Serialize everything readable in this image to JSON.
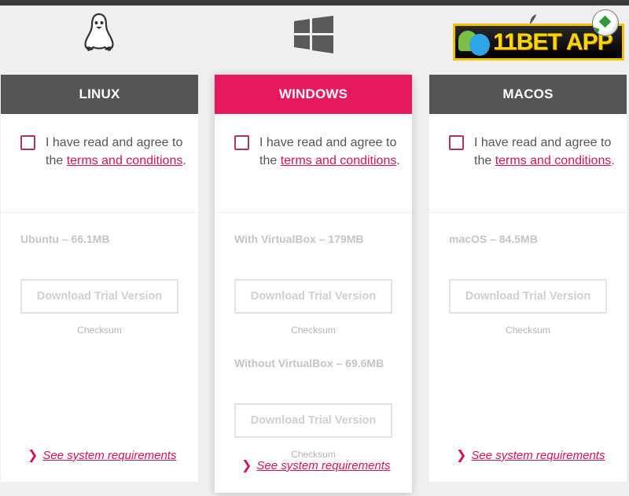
{
  "platforms": [
    {
      "name": "LINUX",
      "icon": "linux-tux-icon",
      "agree_text": "I have read and agree to the",
      "terms_link": "terms and conditions",
      "variants": [
        {
          "label": "Ubuntu – 66.1MB",
          "button": "Download Trial Version",
          "checksum": "Checksum"
        }
      ],
      "sysreq": "See system requirements"
    },
    {
      "name": "WINDOWS",
      "icon": "windows-logo-icon",
      "agree_text": "I have read and agree to the",
      "terms_link": "terms and conditions",
      "variants": [
        {
          "label": "With VirtualBox – 179MB",
          "button": "Download Trial Version",
          "checksum": "Checksum"
        },
        {
          "label": "Without VirtualBox – 69.6MB",
          "button": "Download Trial Version",
          "checksum": "Checksum"
        }
      ],
      "sysreq": "See system requirements"
    },
    {
      "name": "MACOS",
      "icon": "apple-logo-icon",
      "agree_text": "I have read and agree to the",
      "terms_link": "terms and conditions",
      "variants": [
        {
          "label": "macOS – 84.5MB",
          "button": "Download Trial Version",
          "checksum": "Checksum"
        }
      ],
      "sysreq": "See system requirements"
    }
  ],
  "ad": {
    "text": "11BET APP"
  },
  "colors": {
    "accent": "#e8185d",
    "header_dark": "#555555",
    "link": "#d9134f"
  }
}
